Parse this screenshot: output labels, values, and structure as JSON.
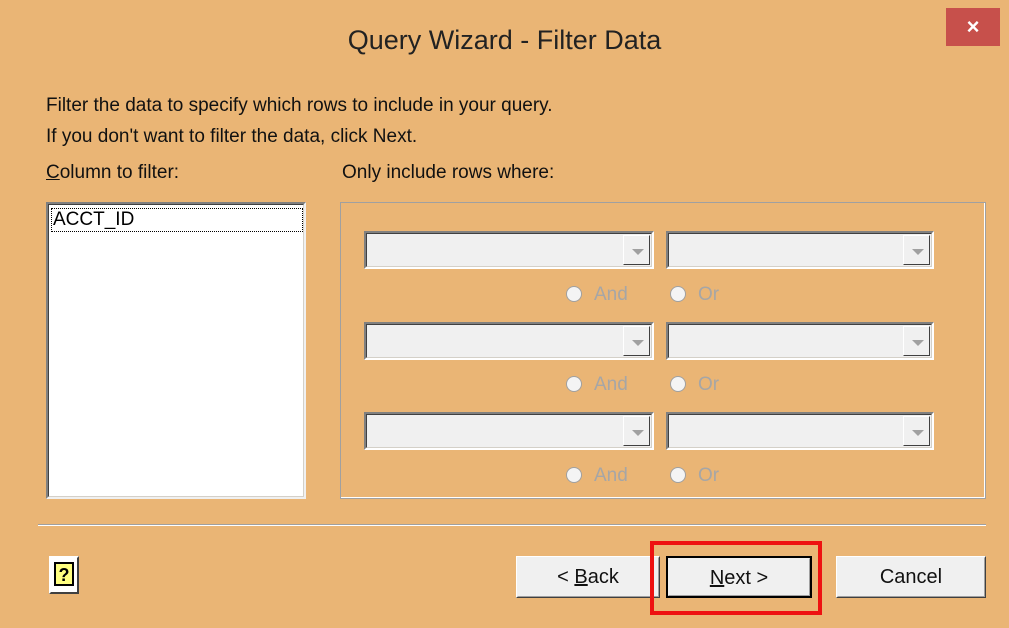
{
  "window": {
    "title": "Query Wizard - Filter Data",
    "close_glyph": "×"
  },
  "instructions": {
    "line1": "Filter the data to specify which rows to include in your query.",
    "line2": "If you don't want to filter the data, click Next."
  },
  "column_to_filter": {
    "label_underlined": "C",
    "label_rest": "olumn to filter:",
    "items": [
      "ACCT_ID"
    ]
  },
  "criteria": {
    "label": "Only include rows where:",
    "and_label": "And",
    "or_label": "Or"
  },
  "buttons": {
    "help_glyph": "?",
    "back_prefix": "< ",
    "back_underlined": "B",
    "back_rest": "ack",
    "next_underlined": "N",
    "next_rest": "ext >",
    "cancel": "Cancel"
  },
  "colors": {
    "titlebar": "#eab575",
    "close": "#c7504b",
    "highlight": "#ee1111"
  }
}
